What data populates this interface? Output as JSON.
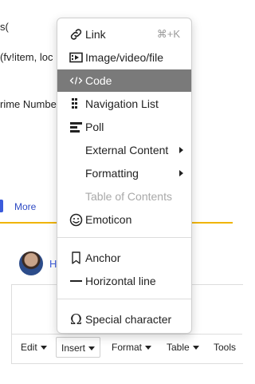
{
  "background": {
    "line1": "s(",
    "line2": "(fv!item, loc",
    "line3": "rime Numbe",
    "more_link": "More",
    "user_initial": "H"
  },
  "toolbar": [
    {
      "label": "Edit",
      "active": false
    },
    {
      "label": "Insert",
      "active": true
    },
    {
      "label": "Format",
      "active": false
    },
    {
      "label": "Table",
      "active": false
    },
    {
      "label": "Tools",
      "active": false
    }
  ],
  "insert_menu": {
    "items": [
      {
        "id": "link",
        "label": "Link",
        "icon": "link-icon",
        "shortcut": "⌘+K"
      },
      {
        "id": "media",
        "label": "Image/video/file",
        "icon": "media-icon"
      },
      {
        "id": "code",
        "label": "Code",
        "icon": "code-icon",
        "highlighted": true
      },
      {
        "id": "navlist",
        "label": "Navigation List",
        "icon": "navigation-list-icon"
      },
      {
        "id": "poll",
        "label": "Poll",
        "icon": "poll-icon"
      },
      {
        "id": "external",
        "label": "External Content",
        "submenu": true
      },
      {
        "id": "formatting",
        "label": "Formatting",
        "submenu": true
      },
      {
        "id": "toc",
        "label": "Table of Contents",
        "disabled": true
      },
      {
        "id": "emoticon",
        "label": "Emoticon",
        "icon": "emoticon-icon"
      },
      {
        "id": "anchor",
        "label": "Anchor",
        "icon": "bookmark-icon"
      },
      {
        "id": "hline",
        "label": "Horizontal line",
        "icon": "horizontal-line-icon"
      },
      {
        "id": "special",
        "label": "Special character",
        "icon": "omega-icon"
      }
    ]
  },
  "colors": {
    "highlight": "#7a7a7a",
    "link": "#2f4bc4",
    "accent_underline": "#f0b400"
  }
}
